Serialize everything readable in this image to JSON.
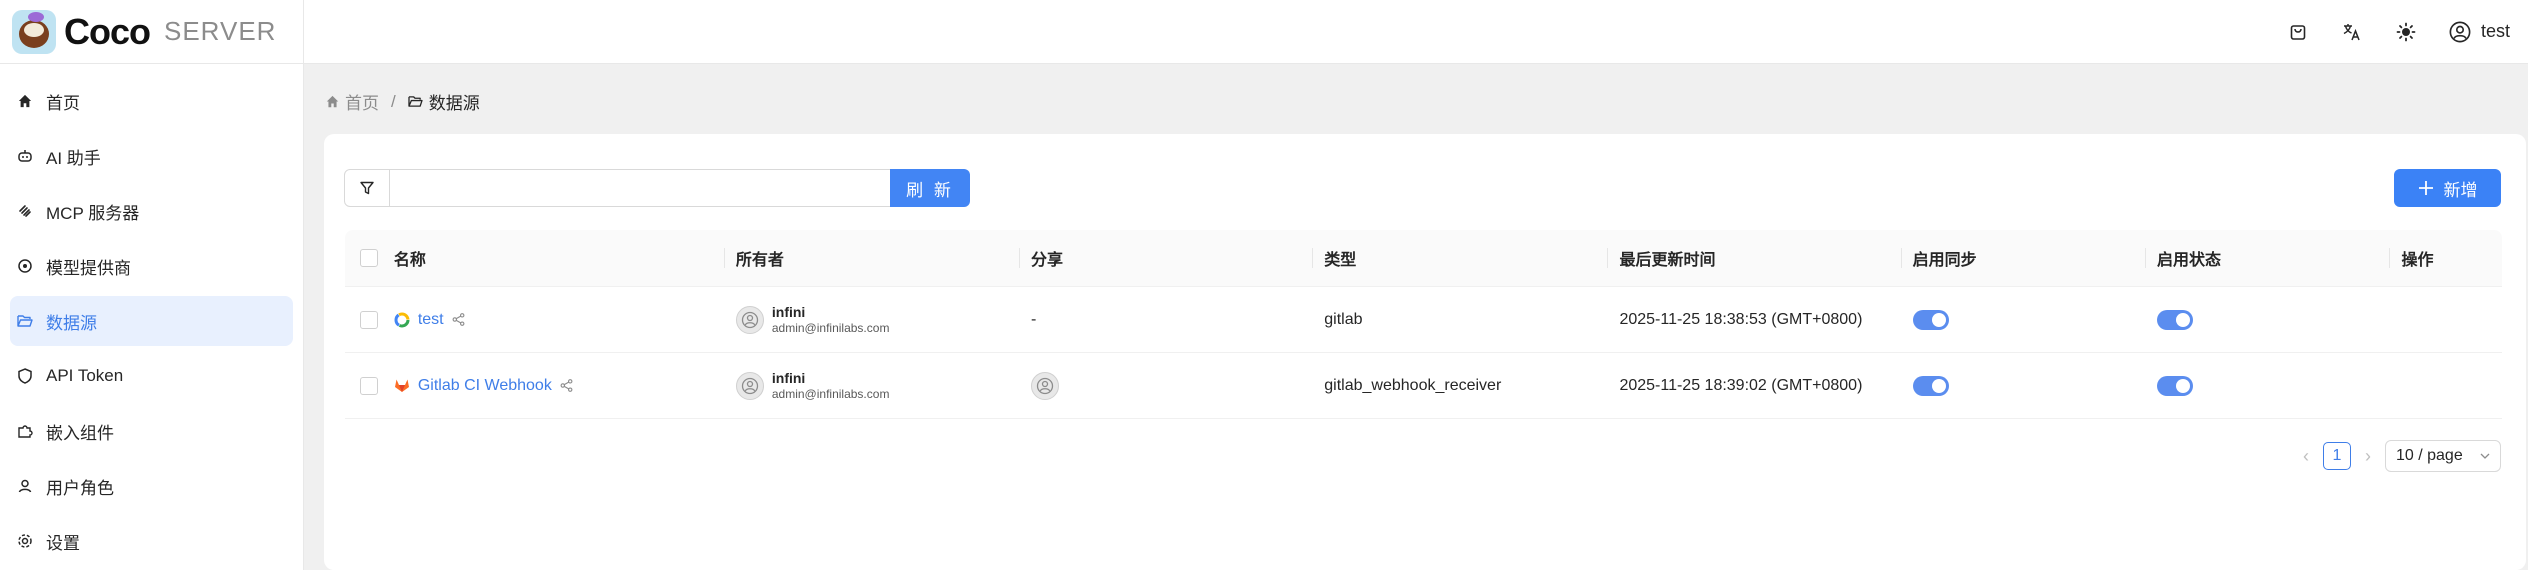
{
  "app": {
    "logo_text": "Coco",
    "logo_sub": "SERVER"
  },
  "sidebar": {
    "items": [
      {
        "label": "首页",
        "icon": "home-icon"
      },
      {
        "label": "AI 助手",
        "icon": "robot-icon"
      },
      {
        "label": "MCP 服务器",
        "icon": "mcp-icon"
      },
      {
        "label": "模型提供商",
        "icon": "model-icon"
      },
      {
        "label": "数据源",
        "icon": "folder-open-icon",
        "active": true
      },
      {
        "label": "API Token",
        "icon": "shield-icon"
      },
      {
        "label": "嵌入组件",
        "icon": "puzzle-icon"
      },
      {
        "label": "用户角色",
        "icon": "user-icon"
      },
      {
        "label": "设置",
        "icon": "gear-icon"
      }
    ]
  },
  "topbar": {
    "username": "test"
  },
  "breadcrumb": {
    "home": "首页",
    "separator": "/",
    "current": "数据源"
  },
  "toolbar": {
    "search_value": "",
    "refresh_label": "刷 新",
    "add_label": "新增"
  },
  "table": {
    "columns": [
      "名称",
      "所有者",
      "分享",
      "类型",
      "最后更新时间",
      "启用同步",
      "启用状态",
      "操作"
    ],
    "rows": [
      {
        "name": "test",
        "icon": "google-drive-icon",
        "owner_name": "infini",
        "owner_email": "admin@infinilabs.com",
        "share": "-",
        "type": "gitlab",
        "updated": "2025-11-25 18:38:53 (GMT+0800)",
        "sync_enabled": true,
        "status_enabled": true
      },
      {
        "name": "Gitlab CI Webhook",
        "icon": "gitlab-icon",
        "owner_name": "infini",
        "owner_email": "admin@infinilabs.com",
        "share": "avatar",
        "type": "gitlab_webhook_receiver",
        "updated": "2025-11-25 18:39:02 (GMT+0800)",
        "sync_enabled": true,
        "status_enabled": true
      }
    ]
  },
  "pagination": {
    "current_page": "1",
    "page_size": "10 / page"
  },
  "colors": {
    "accent": "#3f7ee8",
    "button": "#4285f4",
    "active_bg": "#e8f0fe"
  }
}
